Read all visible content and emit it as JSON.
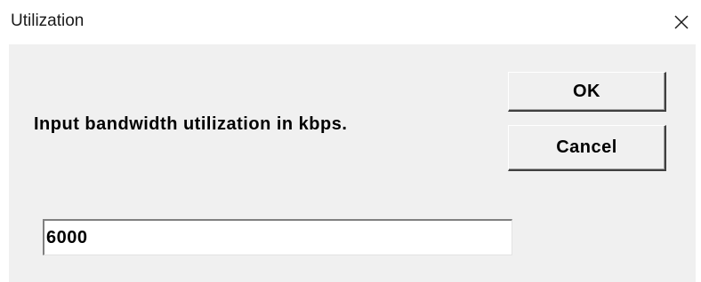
{
  "window": {
    "title": "Utilization",
    "close_icon": "close-icon"
  },
  "prompt": {
    "text": "Input bandwidth utilization in kbps."
  },
  "buttons": {
    "ok_label": "OK",
    "cancel_label": "Cancel"
  },
  "input": {
    "value": "6000"
  },
  "colors": {
    "client_background": "#f0f0f0",
    "title_background": "#ffffff"
  }
}
